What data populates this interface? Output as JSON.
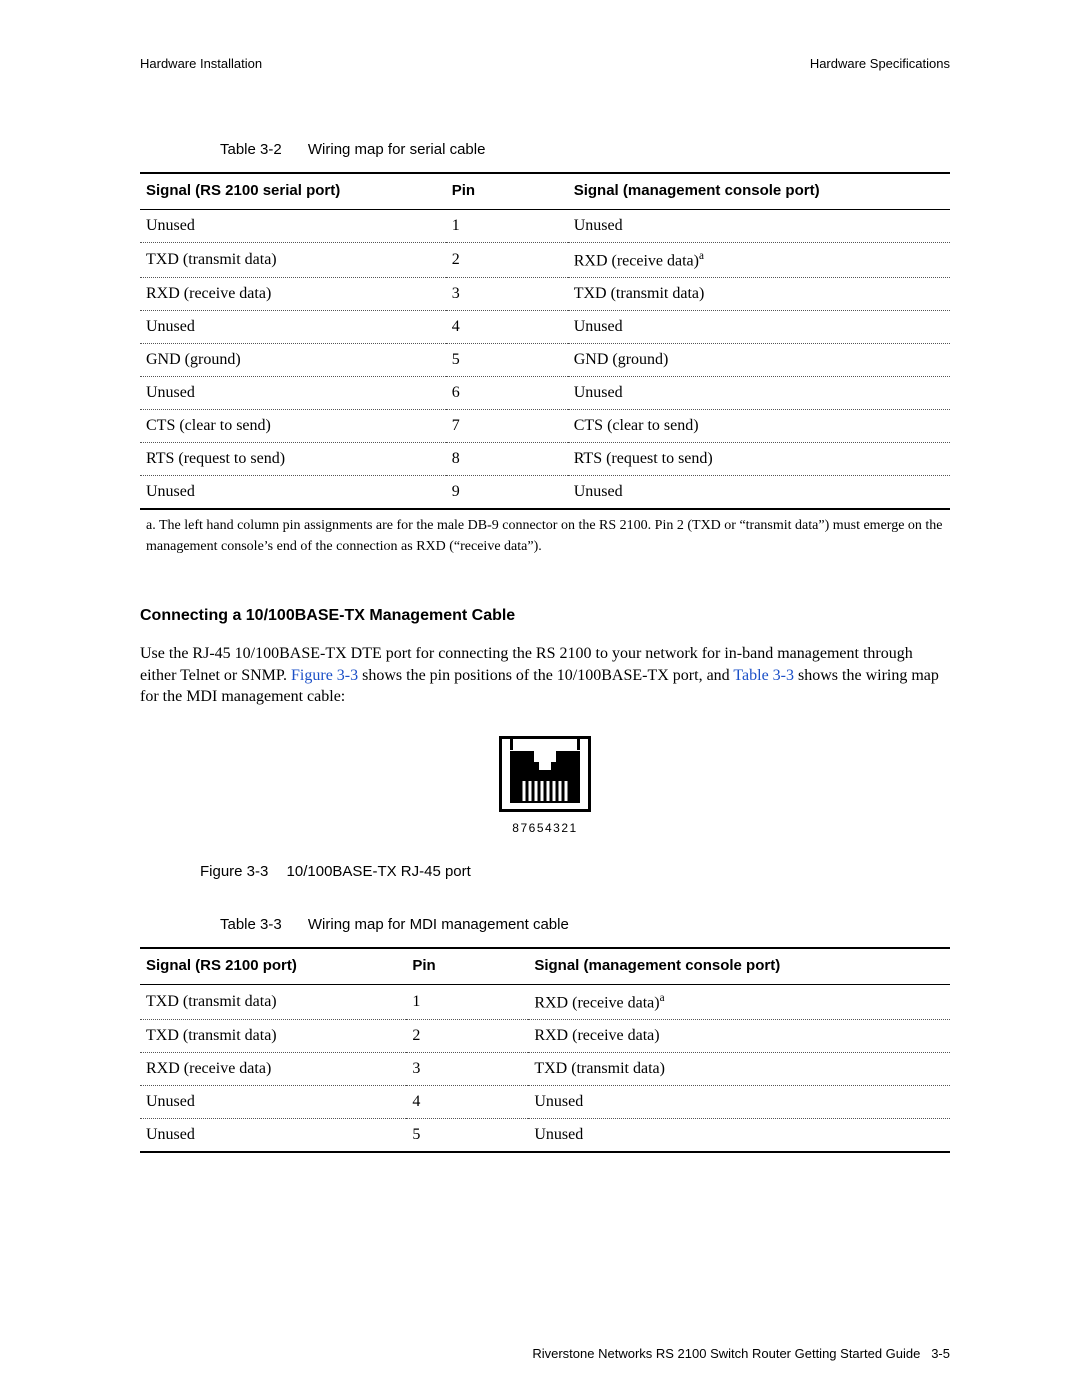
{
  "running_head": {
    "left": "Hardware Installation",
    "right": "Hardware Specifications"
  },
  "table32": {
    "number": "Table 3-2",
    "title": "Wiring map for serial cable",
    "headers": [
      "Signal (RS 2100 serial port)",
      "Pin",
      "Signal (management console port)"
    ],
    "rows": [
      {
        "c0": "Unused",
        "c1": "1",
        "c2": "Unused"
      },
      {
        "c0": "TXD (transmit data)",
        "c1": "2",
        "c2": "RXD (receive data)",
        "c2_sup": "a"
      },
      {
        "c0": "RXD (receive data)",
        "c1": "3",
        "c2": "TXD (transmit data)"
      },
      {
        "c0": "Unused",
        "c1": "4",
        "c2": "Unused"
      },
      {
        "c0": "GND (ground)",
        "c1": "5",
        "c2": "GND (ground)"
      },
      {
        "c0": "Unused",
        "c1": "6",
        "c2": "Unused"
      },
      {
        "c0": "CTS (clear to send)",
        "c1": "7",
        "c2": "CTS (clear to send)"
      },
      {
        "c0": "RTS (request to send)",
        "c1": "8",
        "c2": "RTS (request to send)"
      },
      {
        "c0": "Unused",
        "c1": "9",
        "c2": "Unused"
      }
    ],
    "footnote": "a. The left hand column pin assignments are for the male DB-9 connector on the RS 2100. Pin 2 (TXD or “transmit data”) must emerge on the management console’s end of the connection as RXD (“receive data”)."
  },
  "section": {
    "heading": "Connecting a 10/100BASE-TX Management Cable",
    "para_pre": "Use the RJ-45 10/100BASE-TX DTE port for connecting the RS 2100 to your network for in-band management through either Telnet or SNMP. ",
    "link_fig": "Figure 3-3",
    "para_mid": " shows the pin positions of the 10/100BASE-TX port, and ",
    "link_tab": "Table 3-3",
    "para_post": " shows the wiring map for the MDI management cable:"
  },
  "rj45": {
    "pin_labels": "87654321"
  },
  "figure33": {
    "number": "Figure 3-3",
    "title": "10/100BASE-TX RJ-45 port"
  },
  "table33": {
    "number": "Table 3-3",
    "title": "Wiring map for MDI management cable",
    "headers": [
      "Signal (RS 2100 port)",
      "Pin",
      "Signal (management console port)"
    ],
    "rows": [
      {
        "c0": "TXD (transmit data)",
        "c1": "1",
        "c2": "RXD (receive data)",
        "c2_sup": "a"
      },
      {
        "c0": "TXD (transmit data)",
        "c1": "2",
        "c2": "RXD (receive data)"
      },
      {
        "c0": "RXD (receive data)",
        "c1": "3",
        "c2": "TXD (transmit data)"
      },
      {
        "c0": "Unused",
        "c1": "4",
        "c2": "Unused"
      },
      {
        "c0": "Unused",
        "c1": "5",
        "c2": "Unused"
      }
    ]
  },
  "footer": {
    "text": "Riverstone Networks RS 2100 Switch Router Getting Started Guide",
    "page": "3-5"
  }
}
